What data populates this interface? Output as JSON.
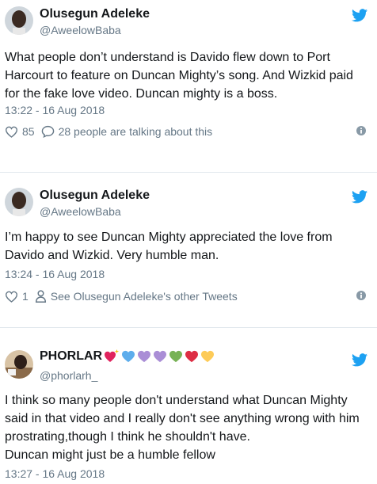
{
  "tweets": [
    {
      "name": "Olusegun Adeleke",
      "handle": "@AweelowBaba",
      "text_lines": [
        "What people don’t understand is Davido flew down to Port",
        "Harcourt to feature on Duncan Mighty’s song. And Wizkid paid",
        "for the fake love video. Duncan mighty is a boss."
      ],
      "timestamp": "13:22 - 16 Aug 2018",
      "likes": "85",
      "secondary_action": "28 people are talking about this",
      "secondary_icon": "reply-bubble-icon"
    },
    {
      "name": "Olusegun Adeleke",
      "handle": "@AweelowBaba",
      "text_lines": [
        "I’m happy to see Duncan Mighty appreciated the love from",
        "Davido and Wizkid. Very humble man."
      ],
      "timestamp": "13:24 - 16 Aug 2018",
      "likes": "1",
      "secondary_action": "See Olusegun Adeleke's other Tweets",
      "secondary_icon": "person-icon"
    },
    {
      "name": "PHORLAR",
      "handle": "@phorlarh_",
      "name_emojis": [
        "sparkling-heart",
        "blue-heart",
        "purple-heart",
        "purple-heart",
        "green-heart",
        "red-heart",
        "yellow-heart"
      ],
      "text_lines": [
        "I think so many people don't understand what Duncan Mighty",
        "said in that video and I  really don't see anything wrong with him",
        "prostrating,though I think he shouldn't have.",
        "Duncan might just be a humble fellow"
      ],
      "timestamp": "13:27 - 16 Aug 2018"
    }
  ],
  "colors": {
    "twitter_blue": "#1da1f2",
    "secondary_text": "#657786",
    "primary_text": "#14171a",
    "separator": "#e1e8ed"
  }
}
